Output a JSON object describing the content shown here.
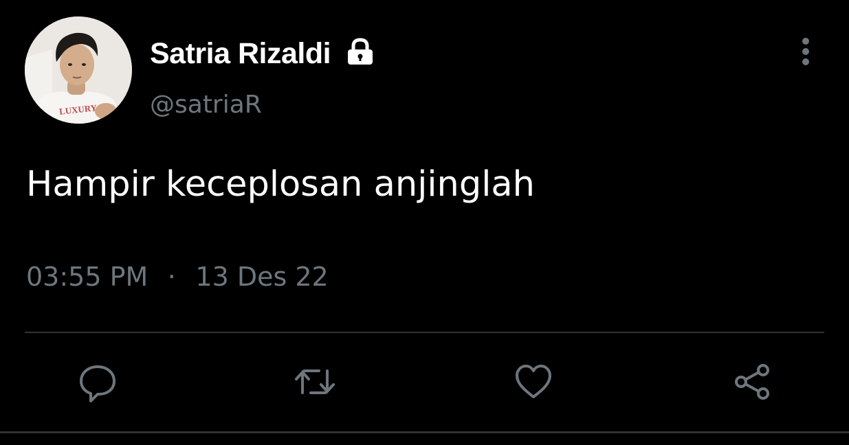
{
  "author": {
    "display_name": "Satria Rizaldi",
    "handle": "@satriaR",
    "protected": true,
    "avatar_shirt_text": "LUXURY"
  },
  "tweet": {
    "text": "Hampir keceplosan anjinglah",
    "time": "03:55 PM",
    "separator": "·",
    "date": "13 Des 22"
  },
  "actions": [
    {
      "name": "reply",
      "icon": "speech-bubble-icon"
    },
    {
      "name": "retweet",
      "icon": "retweet-arrows-icon"
    },
    {
      "name": "like",
      "icon": "heart-icon"
    },
    {
      "name": "share",
      "icon": "share-nodes-icon"
    }
  ],
  "colors": {
    "background": "#000000",
    "primary_text": "#ffffff",
    "secondary_text": "#6e767d",
    "divider": "#2f3336"
  }
}
